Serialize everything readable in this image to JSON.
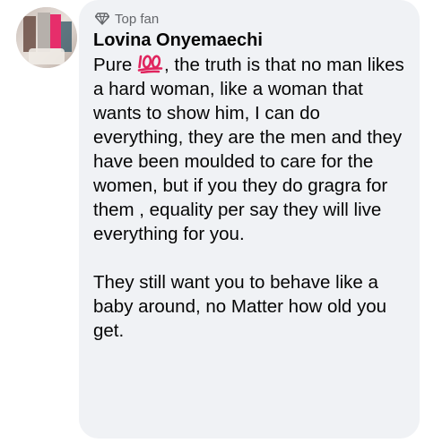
{
  "comment": {
    "badge_label": "Top fan",
    "author": "Lovina Onyemaechi",
    "text_before_emoji": "Pure ",
    "emoji_icon": "hundred-points-icon",
    "text_paragraph_1_rest": ", the truth is that no man likes a hard woman, like a woman that wants to show him, I can do everything, they are the men and they have been moulded to care for the women, but if you they do gragra for them , equality per say they will live everything for you.",
    "text_paragraph_2": "They still want you to behave like a baby around, no Matter how old you get."
  },
  "colors": {
    "bubble_bg": "#f0f2f5",
    "meta_gray": "#65676b",
    "emoji_red": "#e0245e"
  }
}
